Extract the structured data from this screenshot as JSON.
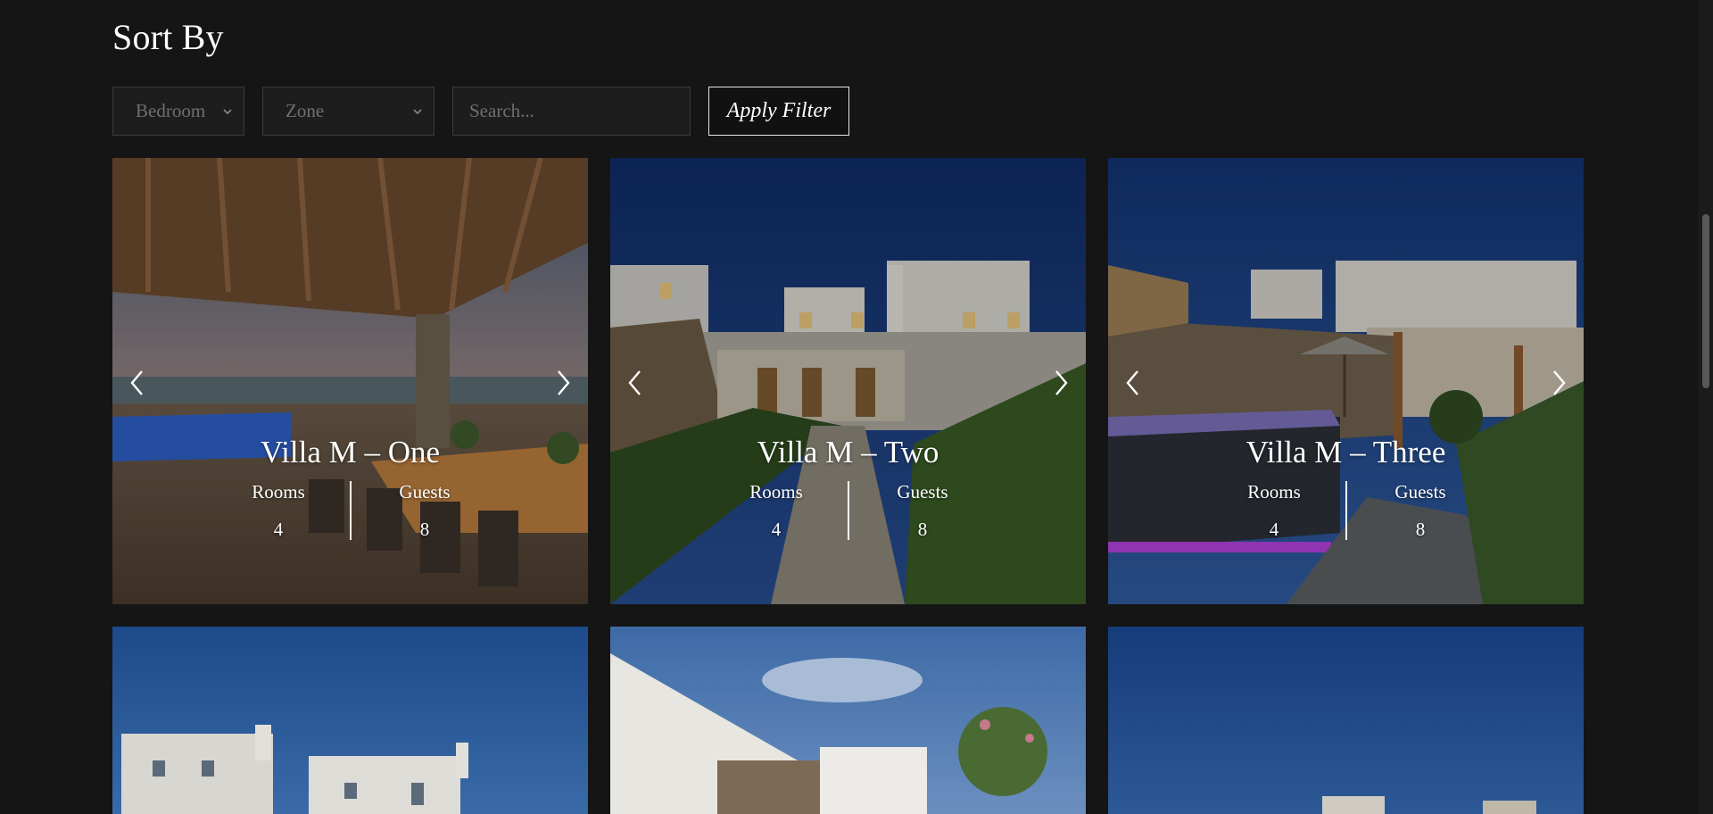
{
  "sort": {
    "heading": "Sort By",
    "bedroom_select": "Bedroom",
    "zone_select": "Zone",
    "search_placeholder": "Search...",
    "apply_label": "Apply Filter"
  },
  "villas": [
    {
      "name": "Villa M – One",
      "rooms_label": "Rooms",
      "rooms": "4",
      "guests_label": "Guests",
      "guests": "8"
    },
    {
      "name": "Villa M – Two",
      "rooms_label": "Rooms",
      "rooms": "4",
      "guests_label": "Guests",
      "guests": "8"
    },
    {
      "name": "Villa M – Three",
      "rooms_label": "Rooms",
      "rooms": "4",
      "guests_label": "Guests",
      "guests": "8"
    }
  ],
  "colors": {
    "background": "#151515",
    "input_bg": "#1d1d1d",
    "input_border": "#3a3a3a",
    "placeholder_text": "#6f6f6f",
    "text": "#ffffff"
  }
}
